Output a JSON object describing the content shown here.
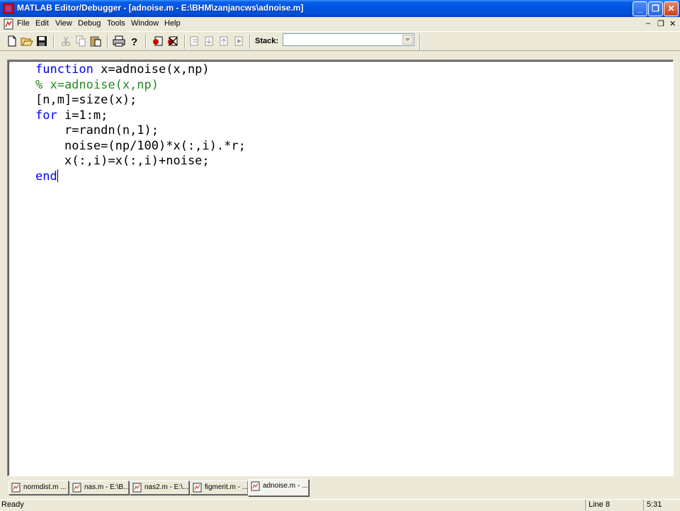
{
  "window": {
    "title": "MATLAB Editor/Debugger - [adnoise.m - E:\\BHM\\zanjancws\\adnoise.m]",
    "minimize_symbol": "_",
    "restore_symbol": "❐",
    "close_symbol": "✕",
    "title_color": "#0055e5"
  },
  "menubar": {
    "items": [
      "File",
      "Edit",
      "View",
      "Debug",
      "Tools",
      "Window",
      "Help"
    ],
    "mdi_minimize": "–",
    "mdi_restore": "❐",
    "mdi_close": "✕"
  },
  "toolbar": {
    "icons": [
      "new-file-icon",
      "open-folder-icon",
      "save-icon",
      "cut-icon",
      "copy-icon",
      "paste-icon",
      "print-icon",
      "help-icon",
      "set-breakpoint-icon",
      "clear-breakpoints-icon",
      "step-icon",
      "step-in-icon",
      "step-out-icon",
      "continue-icon"
    ],
    "stack_label": "Stack:",
    "stack_value": ""
  },
  "editor": {
    "keyword_color": "#0000ff",
    "comment_color": "#228b22",
    "lines": [
      {
        "indent": "",
        "kw": "function",
        "rest": " x=adnoise(x,np)",
        "type": "kw"
      },
      {
        "indent": "",
        "kw": "",
        "rest": "% x=adnoise(x,np)",
        "type": "comment"
      },
      {
        "indent": "",
        "kw": "",
        "rest": "[n,m]=size(x);",
        "type": "plain"
      },
      {
        "indent": "",
        "kw": "for",
        "rest": " i=1:m;",
        "type": "kw"
      },
      {
        "indent": "    ",
        "kw": "",
        "rest": "r=randn(n,1);",
        "type": "plain"
      },
      {
        "indent": "    ",
        "kw": "",
        "rest": "noise=(np/100)*x(:,i).*r;",
        "type": "plain"
      },
      {
        "indent": "    ",
        "kw": "",
        "rest": "x(:,i)=x(:,i)+noise;",
        "type": "plain"
      },
      {
        "indent": "",
        "kw": "end",
        "rest": "",
        "type": "kw-caret"
      }
    ]
  },
  "tabs": [
    {
      "label": "normdist.m ...",
      "active": false
    },
    {
      "label": "nas.m - E:\\B...",
      "active": false
    },
    {
      "label": "nas2.m - E:\\...",
      "active": false
    },
    {
      "label": "figmerit.m - ...",
      "active": false
    },
    {
      "label": "adnoise.m - ...",
      "active": true
    }
  ],
  "statusbar": {
    "status": "Ready",
    "line": "Line 8",
    "time": "5:31"
  }
}
